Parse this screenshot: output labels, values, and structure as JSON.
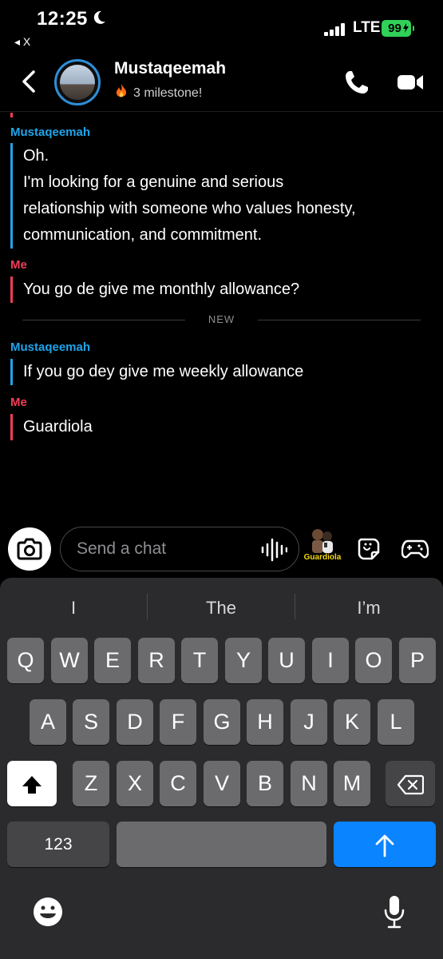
{
  "status_bar": {
    "time": "12:25",
    "back_app": "◂ X",
    "network": "LTE",
    "battery": "99"
  },
  "header": {
    "contact_name": "Mustaqeemah",
    "streak_text": "3 milestone!",
    "icons": [
      "back-chevron-icon",
      "phone-icon",
      "video-camera-icon",
      "fire-icon"
    ]
  },
  "chat": {
    "messages": [
      {
        "sender": "Mustaqeemah",
        "lines": [
          "Oh.",
          "I'm looking for a genuine and serious",
          "relationship with someone who values honesty,",
          "communication, and commitment."
        ]
      },
      {
        "sender": "Me",
        "lines": [
          "You go de give me monthly allowance?"
        ]
      },
      {
        "sender": "Mustaqeemah",
        "lines": [
          "If you go dey give me weekly allowance"
        ]
      },
      {
        "sender": "Me",
        "lines": [
          "Guardiola"
        ]
      }
    ],
    "new_divider": "NEW"
  },
  "input_bar": {
    "placeholder": "Send a chat",
    "bitmoji_label": "Guardiola"
  },
  "keyboard": {
    "suggestions": [
      "I",
      "The",
      "I’m"
    ],
    "row1": [
      "Q",
      "W",
      "E",
      "R",
      "T",
      "Y",
      "U",
      "I",
      "O",
      "P"
    ],
    "row2": [
      "A",
      "S",
      "D",
      "F",
      "G",
      "H",
      "J",
      "K",
      "L"
    ],
    "row3": [
      "Z",
      "X",
      "C",
      "V",
      "B",
      "N",
      "M"
    ],
    "numbers_key": "123"
  },
  "colors": {
    "them": "#1ea4ea",
    "me": "#f23c57",
    "send_key": "#0a84ff",
    "battery": "#30d158"
  }
}
